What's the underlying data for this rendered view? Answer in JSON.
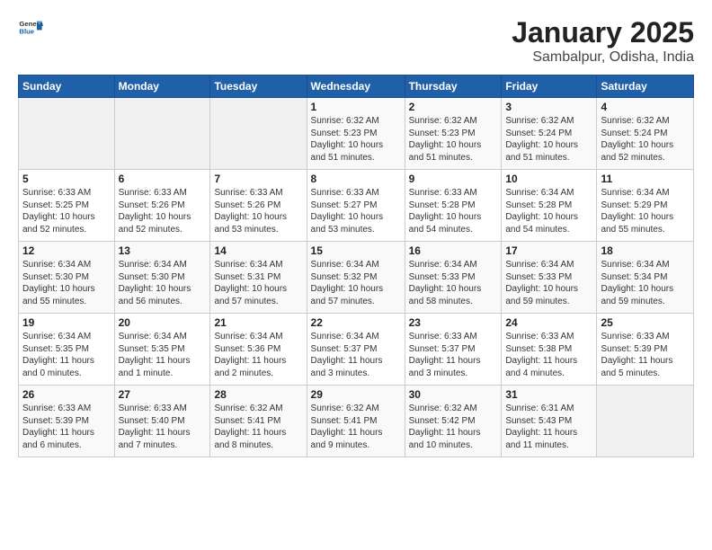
{
  "header": {
    "logo_general": "General",
    "logo_blue": "Blue",
    "title": "January 2025",
    "subtitle": "Sambalpur, Odisha, India"
  },
  "weekdays": [
    "Sunday",
    "Monday",
    "Tuesday",
    "Wednesday",
    "Thursday",
    "Friday",
    "Saturday"
  ],
  "weeks": [
    [
      {
        "day": "",
        "info": ""
      },
      {
        "day": "",
        "info": ""
      },
      {
        "day": "",
        "info": ""
      },
      {
        "day": "1",
        "info": "Sunrise: 6:32 AM\nSunset: 5:23 PM\nDaylight: 10 hours\nand 51 minutes."
      },
      {
        "day": "2",
        "info": "Sunrise: 6:32 AM\nSunset: 5:23 PM\nDaylight: 10 hours\nand 51 minutes."
      },
      {
        "day": "3",
        "info": "Sunrise: 6:32 AM\nSunset: 5:24 PM\nDaylight: 10 hours\nand 51 minutes."
      },
      {
        "day": "4",
        "info": "Sunrise: 6:32 AM\nSunset: 5:24 PM\nDaylight: 10 hours\nand 52 minutes."
      }
    ],
    [
      {
        "day": "5",
        "info": "Sunrise: 6:33 AM\nSunset: 5:25 PM\nDaylight: 10 hours\nand 52 minutes."
      },
      {
        "day": "6",
        "info": "Sunrise: 6:33 AM\nSunset: 5:26 PM\nDaylight: 10 hours\nand 52 minutes."
      },
      {
        "day": "7",
        "info": "Sunrise: 6:33 AM\nSunset: 5:26 PM\nDaylight: 10 hours\nand 53 minutes."
      },
      {
        "day": "8",
        "info": "Sunrise: 6:33 AM\nSunset: 5:27 PM\nDaylight: 10 hours\nand 53 minutes."
      },
      {
        "day": "9",
        "info": "Sunrise: 6:33 AM\nSunset: 5:28 PM\nDaylight: 10 hours\nand 54 minutes."
      },
      {
        "day": "10",
        "info": "Sunrise: 6:34 AM\nSunset: 5:28 PM\nDaylight: 10 hours\nand 54 minutes."
      },
      {
        "day": "11",
        "info": "Sunrise: 6:34 AM\nSunset: 5:29 PM\nDaylight: 10 hours\nand 55 minutes."
      }
    ],
    [
      {
        "day": "12",
        "info": "Sunrise: 6:34 AM\nSunset: 5:30 PM\nDaylight: 10 hours\nand 55 minutes."
      },
      {
        "day": "13",
        "info": "Sunrise: 6:34 AM\nSunset: 5:30 PM\nDaylight: 10 hours\nand 56 minutes."
      },
      {
        "day": "14",
        "info": "Sunrise: 6:34 AM\nSunset: 5:31 PM\nDaylight: 10 hours\nand 57 minutes."
      },
      {
        "day": "15",
        "info": "Sunrise: 6:34 AM\nSunset: 5:32 PM\nDaylight: 10 hours\nand 57 minutes."
      },
      {
        "day": "16",
        "info": "Sunrise: 6:34 AM\nSunset: 5:33 PM\nDaylight: 10 hours\nand 58 minutes."
      },
      {
        "day": "17",
        "info": "Sunrise: 6:34 AM\nSunset: 5:33 PM\nDaylight: 10 hours\nand 59 minutes."
      },
      {
        "day": "18",
        "info": "Sunrise: 6:34 AM\nSunset: 5:34 PM\nDaylight: 10 hours\nand 59 minutes."
      }
    ],
    [
      {
        "day": "19",
        "info": "Sunrise: 6:34 AM\nSunset: 5:35 PM\nDaylight: 11 hours\nand 0 minutes."
      },
      {
        "day": "20",
        "info": "Sunrise: 6:34 AM\nSunset: 5:35 PM\nDaylight: 11 hours\nand 1 minute."
      },
      {
        "day": "21",
        "info": "Sunrise: 6:34 AM\nSunset: 5:36 PM\nDaylight: 11 hours\nand 2 minutes."
      },
      {
        "day": "22",
        "info": "Sunrise: 6:34 AM\nSunset: 5:37 PM\nDaylight: 11 hours\nand 3 minutes."
      },
      {
        "day": "23",
        "info": "Sunrise: 6:33 AM\nSunset: 5:37 PM\nDaylight: 11 hours\nand 3 minutes."
      },
      {
        "day": "24",
        "info": "Sunrise: 6:33 AM\nSunset: 5:38 PM\nDaylight: 11 hours\nand 4 minutes."
      },
      {
        "day": "25",
        "info": "Sunrise: 6:33 AM\nSunset: 5:39 PM\nDaylight: 11 hours\nand 5 minutes."
      }
    ],
    [
      {
        "day": "26",
        "info": "Sunrise: 6:33 AM\nSunset: 5:39 PM\nDaylight: 11 hours\nand 6 minutes."
      },
      {
        "day": "27",
        "info": "Sunrise: 6:33 AM\nSunset: 5:40 PM\nDaylight: 11 hours\nand 7 minutes."
      },
      {
        "day": "28",
        "info": "Sunrise: 6:32 AM\nSunset: 5:41 PM\nDaylight: 11 hours\nand 8 minutes."
      },
      {
        "day": "29",
        "info": "Sunrise: 6:32 AM\nSunset: 5:41 PM\nDaylight: 11 hours\nand 9 minutes."
      },
      {
        "day": "30",
        "info": "Sunrise: 6:32 AM\nSunset: 5:42 PM\nDaylight: 11 hours\nand 10 minutes."
      },
      {
        "day": "31",
        "info": "Sunrise: 6:31 AM\nSunset: 5:43 PM\nDaylight: 11 hours\nand 11 minutes."
      },
      {
        "day": "",
        "info": ""
      }
    ]
  ]
}
